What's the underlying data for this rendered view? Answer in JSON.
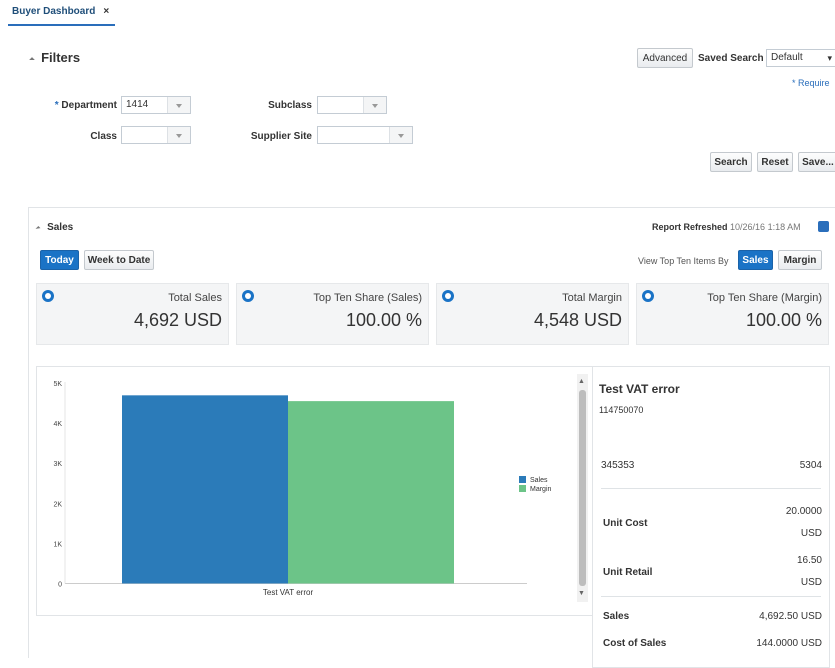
{
  "tab": {
    "label": "Buyer Dashboard",
    "close": "×"
  },
  "filters": {
    "title": "Filters",
    "advanced_label": "Advanced",
    "saved_search_label": "Saved Search",
    "saved_search_value": "Default",
    "required_note": "* Require",
    "department_label": "Department",
    "department_value": "1414",
    "class_label": "Class",
    "subclass_label": "Subclass",
    "supplier_site_label": "Supplier Site",
    "required_star": "*",
    "search_label": "Search",
    "reset_label": "Reset",
    "save_label": "Save..."
  },
  "sales": {
    "title": "Sales",
    "report_refreshed_label": "Report Refreshed",
    "report_refreshed_value": "10/26/16 1:18 AM",
    "today_label": "Today",
    "week_to_date_label": "Week to Date",
    "view_top_ten_label": "View Top Ten Items By",
    "sales_btn": "Sales",
    "margin_btn": "Margin",
    "metrics": [
      {
        "title": "Total Sales",
        "value": "4,692 USD"
      },
      {
        "title": "Top Ten Share (Sales)",
        "value": "100.00 %"
      },
      {
        "title": "Total Margin",
        "value": "4,548 USD"
      },
      {
        "title": "Top Ten Share (Margin)",
        "value": "100.00 %"
      }
    ]
  },
  "chart_data": {
    "type": "bar",
    "categories": [
      "Test VAT error"
    ],
    "series": [
      {
        "name": "Sales",
        "values": [
          4692.5
        ],
        "color": "#2b7bb9"
      },
      {
        "name": "Margin",
        "values": [
          4548
        ],
        "color": "#6cc488"
      }
    ],
    "y_ticks": [
      "0",
      "1K",
      "2K",
      "3K",
      "4K",
      "5K"
    ],
    "ylim": [
      0,
      5000
    ],
    "legend": "right"
  },
  "detail": {
    "item_name": "Test VAT error",
    "item_id": "114750070",
    "row_id": "345353",
    "row_value": "5304",
    "unit_cost_label": "Unit Cost",
    "unit_cost_value": "20.0000",
    "unit_cost_currency": "USD",
    "unit_retail_label": "Unit Retail",
    "unit_retail_value": "16.50",
    "unit_retail_currency": "USD",
    "sales_label": "Sales",
    "sales_value": "4,692.50",
    "sales_currency": "USD",
    "cost_of_sales_label": "Cost of Sales",
    "cost_of_sales_value": "144.0000",
    "cost_of_sales_currency": "USD"
  }
}
